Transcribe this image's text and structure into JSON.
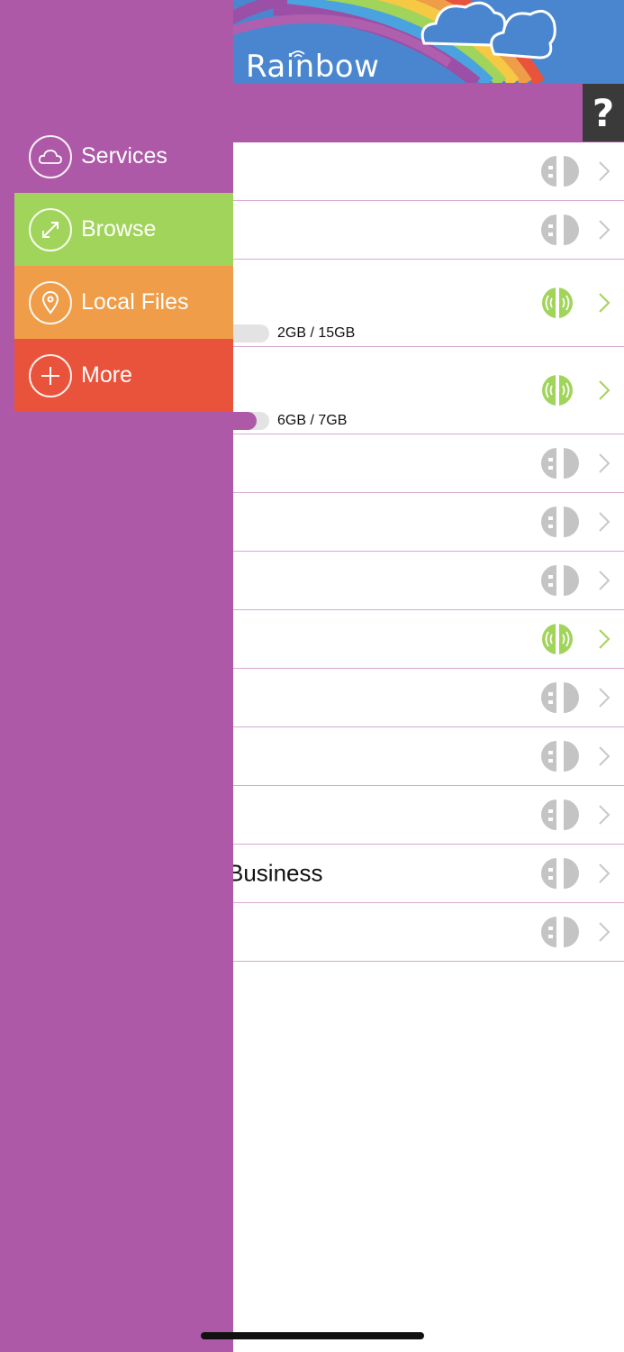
{
  "app": {
    "title": "Rainbow"
  },
  "header": {
    "help_label": "?"
  },
  "menu": {
    "items": [
      {
        "label": "Services",
        "icon": "cloud-icon"
      },
      {
        "label": "Browse",
        "icon": "expand-arrows-icon",
        "color": "#a1d45a"
      },
      {
        "label": "Local Files",
        "icon": "location-pin-icon",
        "color": "#ef9d48"
      },
      {
        "label": "More",
        "icon": "plus-icon",
        "color": "#e9523b"
      }
    ]
  },
  "colors": {
    "drawer": "#ad59a7",
    "connected": "#a1d45a",
    "disconnected": "#c4c4c4",
    "help_bg": "#3a3a3a"
  },
  "services": [
    {
      "label": "",
      "status": "disconnected"
    },
    {
      "label": "",
      "status": "disconnected"
    },
    {
      "label": "",
      "status": "connected",
      "quota": "2GB / 15GB",
      "quota_fraction": 0.13
    },
    {
      "label": "",
      "status": "connected",
      "quota": "6GB / 7GB",
      "quota_fraction": 0.86
    },
    {
      "label": "",
      "status": "disconnected"
    },
    {
      "label": "",
      "status": "disconnected"
    },
    {
      "label": "",
      "status": "disconnected"
    },
    {
      "label": "",
      "status": "connected"
    },
    {
      "label": "",
      "status": "disconnected"
    },
    {
      "label": "",
      "status": "disconnected"
    },
    {
      "label": "",
      "status": "disconnected"
    },
    {
      "label": "Business",
      "status": "disconnected"
    },
    {
      "label": "",
      "status": "disconnected"
    }
  ]
}
